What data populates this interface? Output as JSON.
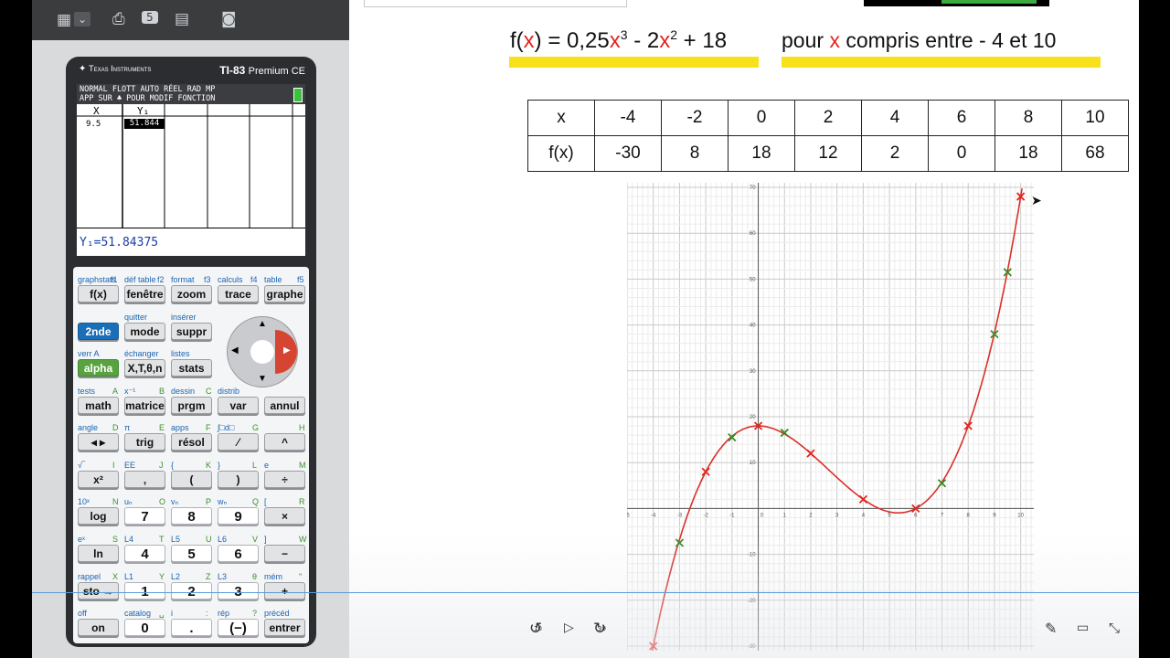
{
  "toolbar": {
    "icons": [
      "calculator-icon",
      "chevron-down-icon",
      "screenshot-icon",
      "recording-icon",
      "layout-icon",
      "camera-icon"
    ],
    "rec_badge": "5"
  },
  "calculator": {
    "brand": "Texas Instruments",
    "model_bold": "TI-83",
    "model_light": "Premium CE",
    "status_line1": "NORMAL FLOTT AUTO RÉEL RAD MP",
    "status_line2": "APP SUR ♣ POUR MODIF FONCTION",
    "col_x": "X",
    "col_y": "Y₁",
    "row_x": "9.5",
    "row_y": "51.844",
    "bottom_line": "Y₁=51.84375",
    "rows": [
      {
        "secondary": [
          [
            "graphstats",
            "f1"
          ],
          [
            "déf table",
            "f2"
          ],
          [
            "format",
            "f3"
          ],
          [
            "calculs",
            "f4"
          ],
          [
            "table",
            "f5"
          ]
        ],
        "keys": [
          "f(x)",
          "fenêtre",
          "zoom",
          "trace",
          "graphe"
        ]
      },
      {
        "secondary": [
          [
            "",
            ""
          ],
          [
            "quitter",
            ""
          ],
          [
            "insérer",
            ""
          ],
          [
            "",
            ""
          ],
          [
            "",
            ""
          ]
        ],
        "keys": [
          "2nde",
          "mode",
          "suppr",
          "",
          ""
        ]
      },
      {
        "secondary": [
          [
            "verr A",
            ""
          ],
          [
            "échanger",
            ""
          ],
          [
            "listes",
            ""
          ],
          [
            "",
            ""
          ],
          [
            "",
            ""
          ]
        ],
        "keys": [
          "alpha",
          "X,T,θ,n",
          "stats",
          "",
          ""
        ]
      },
      {
        "secondary": [
          [
            "tests",
            "A"
          ],
          [
            "x⁻¹",
            "B"
          ],
          [
            "dessin",
            "C"
          ],
          [
            "distrib",
            ""
          ],
          [
            "",
            ""
          ]
        ],
        "keys": [
          "math",
          "matrice",
          "prgm",
          "var",
          "annul"
        ]
      },
      {
        "secondary": [
          [
            "angle",
            "D"
          ],
          [
            "π",
            "E"
          ],
          [
            "apps",
            "F"
          ],
          [
            "∫□d□",
            "G"
          ],
          [
            "",
            "H"
          ]
        ],
        "keys": [
          "◂ ▸",
          "trig",
          "résol",
          "⁄",
          "^"
        ]
      },
      {
        "secondary": [
          [
            "√‾",
            "I"
          ],
          [
            "EE",
            "J"
          ],
          [
            "{",
            "K"
          ],
          [
            "}",
            "L"
          ],
          [
            "e",
            "M"
          ]
        ],
        "keys": [
          "x²",
          ",",
          "(",
          ")",
          "÷"
        ]
      },
      {
        "secondary": [
          [
            "10ˣ",
            "N"
          ],
          [
            "uₙ",
            "O"
          ],
          [
            "vₙ",
            "P"
          ],
          [
            "wₙ",
            "Q"
          ],
          [
            "[",
            "R"
          ]
        ],
        "keys": [
          "log",
          "7",
          "8",
          "9",
          "×"
        ]
      },
      {
        "secondary": [
          [
            "eˣ",
            "S"
          ],
          [
            "L4",
            "T"
          ],
          [
            "L5",
            "U"
          ],
          [
            "L6",
            "V"
          ],
          [
            "]",
            "W"
          ]
        ],
        "keys": [
          "ln",
          "4",
          "5",
          "6",
          "−"
        ]
      },
      {
        "secondary": [
          [
            "rappel",
            "X"
          ],
          [
            "L1",
            "Y"
          ],
          [
            "L2",
            "Z"
          ],
          [
            "L3",
            "θ"
          ],
          [
            "mém",
            "\""
          ]
        ],
        "keys": [
          "sto →",
          "1",
          "2",
          "3",
          "+"
        ]
      },
      {
        "secondary": [
          [
            "off",
            ""
          ],
          [
            "catalog",
            "␣"
          ],
          [
            "i",
            ":"
          ],
          [
            "rép",
            "?"
          ],
          [
            "précéd",
            ""
          ]
        ],
        "keys": [
          "on",
          "0",
          ".",
          "(−)",
          "entrer"
        ]
      }
    ]
  },
  "slide": {
    "formula": {
      "f": "f(",
      "x": "x",
      "rest1": ") = 0,25",
      "x2": "x",
      "exp3": "3",
      "mid": " - 2",
      "x3": "x",
      "exp2": "2",
      "end": " + 18"
    },
    "range_text": {
      "pre": "pour ",
      "x": "x",
      "post": " compris entre - 4 et 10"
    },
    "highlight_color": "#f7e11a",
    "table": {
      "row1_label": "x",
      "row2_label": "f(x)",
      "x_values": [
        "-4",
        "-2",
        "0",
        "2",
        "4",
        "6",
        "8",
        "10"
      ],
      "fx_values": [
        "-30",
        "8",
        "18",
        "12",
        "2",
        "0",
        "18",
        "68"
      ]
    }
  },
  "chart_data": {
    "type": "scatter",
    "function": "0.25x^3 - 2x^2 + 18",
    "xlim": [
      -5,
      10.5
    ],
    "ylim": [
      -31,
      71
    ],
    "grid": true,
    "x_ticks": [
      "-5",
      "-4",
      "-3",
      "-2",
      "-1",
      "0",
      "1",
      "2",
      "3",
      "4",
      "5",
      "6",
      "7",
      "8",
      "9",
      "10"
    ],
    "y_ticks": [
      "70",
      "60",
      "50",
      "40",
      "30",
      "20",
      "10",
      "-10",
      "-20",
      "-30"
    ],
    "curve_color": "#d9302a",
    "red_points": {
      "x": [
        -4,
        -2,
        0,
        2,
        4,
        6,
        8,
        10
      ],
      "y": [
        -30,
        8,
        18,
        12,
        2,
        0,
        18,
        68
      ]
    },
    "green_points": {
      "x": [
        -3,
        -1,
        1,
        7,
        9,
        9.5
      ],
      "y": [
        -7.5,
        15.5,
        16.5,
        5.5,
        38,
        51.5
      ]
    }
  },
  "player": {
    "rewind_label": "10",
    "forward_label": "30"
  }
}
